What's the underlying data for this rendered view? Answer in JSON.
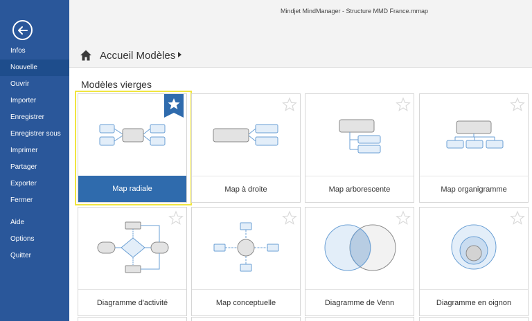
{
  "window": {
    "title": "Mindjet MindManager - Structure MMD France.mmap"
  },
  "sidebar": {
    "items": [
      {
        "label": "Infos"
      },
      {
        "label": "Nouvelle"
      },
      {
        "label": "Ouvrir"
      },
      {
        "label": "Importer"
      },
      {
        "label": "Enregistrer"
      },
      {
        "label": "Enregistrer sous"
      },
      {
        "label": "Imprimer"
      },
      {
        "label": "Partager"
      },
      {
        "label": "Exporter"
      },
      {
        "label": "Fermer"
      },
      {
        "label": "Aide"
      },
      {
        "label": "Options"
      },
      {
        "label": "Quitter"
      }
    ],
    "active_index": 1
  },
  "breadcrumb": {
    "label": "Accueil Modèles"
  },
  "section": {
    "title": "Modèles vierges"
  },
  "templates": [
    {
      "label": "Map radiale",
      "selected": true,
      "favorite": true
    },
    {
      "label": "Map à droite",
      "selected": false,
      "favorite": false
    },
    {
      "label": "Map arborescente",
      "selected": false,
      "favorite": false
    },
    {
      "label": "Map organigramme",
      "selected": false,
      "favorite": false
    },
    {
      "label": "Diagramme d'activité",
      "selected": false,
      "favorite": false
    },
    {
      "label": "Map conceptuelle",
      "selected": false,
      "favorite": false
    },
    {
      "label": "Diagramme de Venn",
      "selected": false,
      "favorite": false
    },
    {
      "label": "Diagramme en oignon",
      "selected": false,
      "favorite": false
    }
  ],
  "colors": {
    "sidebar": "#2a579a",
    "selected_tile": "#2f6bad",
    "highlight": "#f0e540",
    "node_blue": "#6a9fd4",
    "node_gray": "#8a8a8a"
  }
}
